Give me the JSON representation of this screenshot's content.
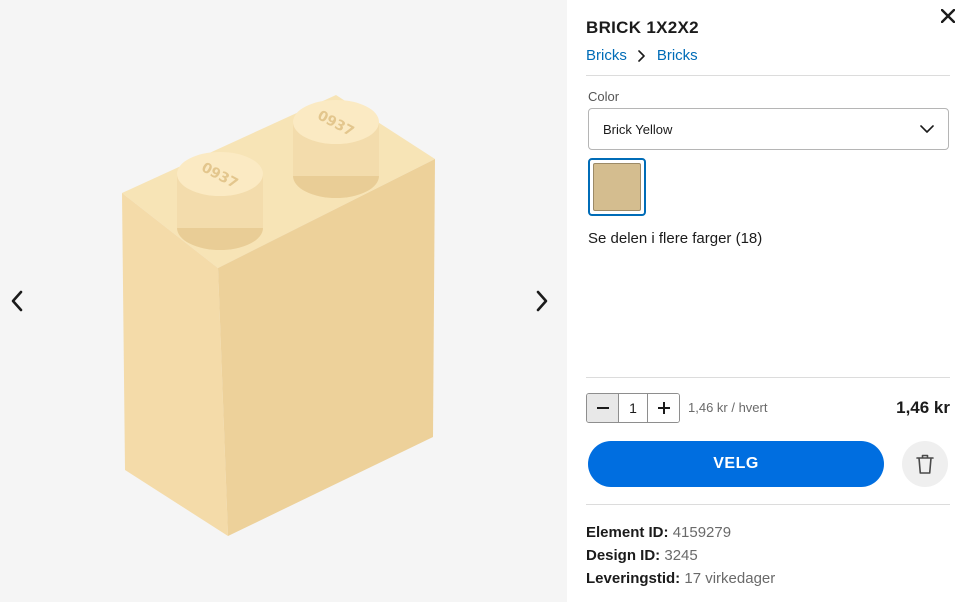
{
  "product": {
    "title": "BRICK 1X2X2",
    "breadcrumb": [
      "Bricks",
      "Bricks"
    ]
  },
  "color": {
    "label": "Color",
    "selected": "Brick Yellow",
    "swatch_hex": "#d4bd8f",
    "more_colors": "Se delen i flere farger (18)"
  },
  "purchase": {
    "quantity": "1",
    "unit_price": "1,46 kr / hvert",
    "total_price": "1,46 kr",
    "select_button": "VELG"
  },
  "details": {
    "element_id_label": "Element ID:",
    "element_id": "4159279",
    "design_id_label": "Design ID:",
    "design_id": "3245",
    "delivery_label": "Leveringstid:",
    "delivery": "17 virkedager"
  },
  "icons": {
    "prev": "chevron-left-icon",
    "next": "chevron-right-icon",
    "close": "close-icon",
    "dropdown": "chevron-down-icon",
    "breadcrumb_separator": "chevron-right-icon",
    "minus": "minus-icon",
    "plus": "plus-icon",
    "trash": "trash-icon"
  },
  "colors": {
    "accent": "#006ee0",
    "link": "#006cb7",
    "gallery_bg": "#f5f5f5",
    "brick": "#f6dfad"
  }
}
